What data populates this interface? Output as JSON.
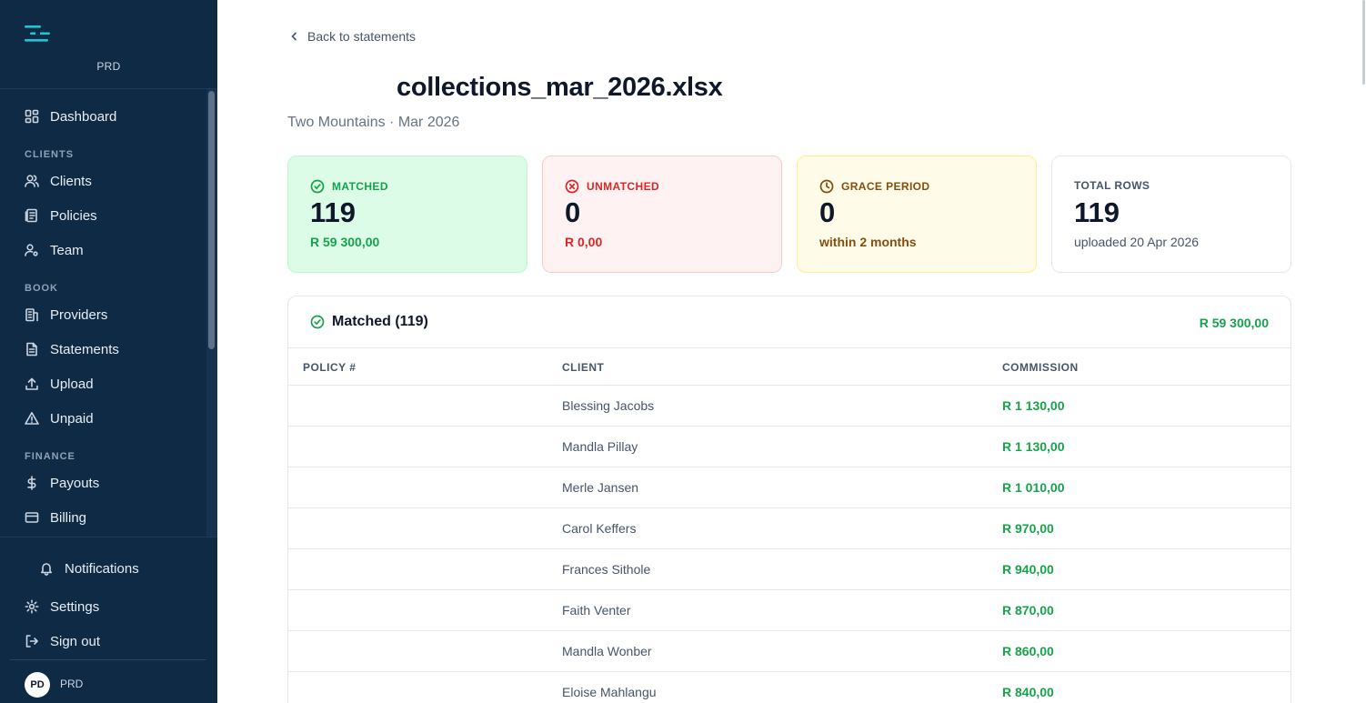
{
  "sidebar": {
    "org": "PRD",
    "items": {
      "dashboard": "Dashboard",
      "clients": "Clients",
      "policies": "Policies",
      "team": "Team",
      "providers": "Providers",
      "statements": "Statements",
      "upload": "Upload",
      "unpaid": "Unpaid",
      "payouts": "Payouts",
      "billing": "Billing"
    },
    "sections": {
      "clients": "CLIENTS",
      "book": "BOOK",
      "finance": "FINANCE"
    },
    "footer": {
      "notifications": "Notifications",
      "settings": "Settings",
      "sign_out": "Sign out",
      "avatar_initials": "PD",
      "user_name": "PRD"
    }
  },
  "main": {
    "back_label": "Back to statements",
    "title": "collections_mar_2026.xlsx",
    "subtitle": "Two Mountains · Mar 2026",
    "cards": {
      "matched": {
        "label": "MATCHED",
        "value": "119",
        "sub": "R 59 300,00"
      },
      "unmatched": {
        "label": "UNMATCHED",
        "value": "0",
        "sub": "R 0,00"
      },
      "grace": {
        "label": "GRACE PERIOD",
        "value": "0",
        "sub": "within 2 months"
      },
      "total": {
        "label": "TOTAL ROWS",
        "value": "119",
        "sub": "uploaded 20 Apr 2026"
      }
    },
    "panel": {
      "title": "Matched (119)",
      "total": "R 59 300,00",
      "columns": [
        "POLICY #",
        "CLIENT",
        "COMMISSION"
      ],
      "rows": [
        {
          "policy": "",
          "client": "Blessing Jacobs",
          "commission": "R 1 130,00"
        },
        {
          "policy": "",
          "client": "Mandla Pillay",
          "commission": "R 1 130,00"
        },
        {
          "policy": "",
          "client": "Merle Jansen",
          "commission": "R 1 010,00"
        },
        {
          "policy": "",
          "client": "Carol Keffers",
          "commission": "R 970,00"
        },
        {
          "policy": "",
          "client": "Frances Sithole",
          "commission": "R 940,00"
        },
        {
          "policy": "",
          "client": "Faith Venter",
          "commission": "R 870,00"
        },
        {
          "policy": "",
          "client": "Mandla Wonber",
          "commission": "R 860,00"
        },
        {
          "policy": "",
          "client": "Eloise Mahlangu",
          "commission": "R 840,00"
        }
      ]
    }
  },
  "colors": {
    "sidebar_bg": "#0f2a45",
    "accent_cyan": "#22c3d6",
    "success": "#16a34a",
    "danger": "#dc2626",
    "warning": "#854d0e"
  }
}
